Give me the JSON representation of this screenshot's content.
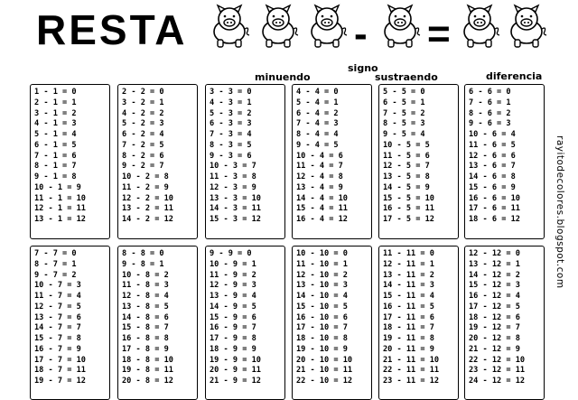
{
  "header": {
    "title": "RESTA",
    "minus_sign": "-",
    "equals_sign": "=",
    "labels": {
      "minuend": "minuendo",
      "sign": "signo",
      "subtrahend": "sustraendo",
      "difference": "diferencia"
    }
  },
  "watermark": "rayitodecolores.blogspot.com",
  "tables": [
    [
      "1 - 1 = 0",
      "2 - 1 = 1",
      "3 - 1 = 2",
      "4 - 1 = 3",
      "5 - 1 = 4",
      "6 - 1 = 5",
      "7 - 1 = 6",
      "8 - 1 = 7",
      "9 - 1 = 8",
      "10 - 1 = 9",
      "11 - 1 = 10",
      "12 - 1 = 11",
      "13 - 1 = 12"
    ],
    [
      "2 - 2 = 0",
      "3 - 2 = 1",
      "4 - 2 = 2",
      "5 - 2 = 3",
      "6 - 2 = 4",
      "7 - 2 = 5",
      "8 - 2 = 6",
      "9 - 2 = 7",
      "10 - 2 = 8",
      "11 - 2 = 9",
      "12 - 2 = 10",
      "13 - 2 = 11",
      "14 - 2 = 12"
    ],
    [
      "3 - 3 = 0",
      "4 - 3 = 1",
      "5 - 3 = 2",
      "6 - 3 = 3",
      "7 - 3 = 4",
      "8 - 3 = 5",
      "9 - 3 = 6",
      "10 - 3 = 7",
      "11 - 3 = 8",
      "12 - 3 = 9",
      "13 - 3 = 10",
      "14 - 3 = 11",
      "15 - 3 = 12"
    ],
    [
      "4 - 4 = 0",
      "5 - 4 = 1",
      "6 - 4 = 2",
      "7 - 4 = 3",
      "8 - 4 = 4",
      "9 - 4 = 5",
      "10 - 4 = 6",
      "11 - 4 = 7",
      "12 - 4 = 8",
      "13 - 4 = 9",
      "14 - 4 = 10",
      "15 - 4 = 11",
      "16 - 4 = 12"
    ],
    [
      "5 - 5 = 0",
      "6 - 5 = 1",
      "7 - 5 = 2",
      "8 - 5 = 3",
      "9 - 5 = 4",
      "10 - 5 = 5",
      "11 - 5 = 6",
      "12 - 5 = 7",
      "13 - 5 = 8",
      "14 - 5 = 9",
      "15 - 5 = 10",
      "16 - 5 = 11",
      "17 - 5 = 12"
    ],
    [
      "6 - 6 = 0",
      "7 - 6 = 1",
      "8 - 6 = 2",
      "9 - 6 = 3",
      "10 - 6 = 4",
      "11 - 6 = 5",
      "12 - 6 = 6",
      "13 - 6 = 7",
      "14 - 6 = 8",
      "15 - 6 = 9",
      "16 - 6 = 10",
      "17 - 6 = 11",
      "18 - 6 = 12"
    ],
    [
      "7 - 7 = 0",
      "8 - 7 = 1",
      "9 - 7 = 2",
      "10 - 7 = 3",
      "11 - 7 = 4",
      "12 - 7 = 5",
      "13 - 7 = 6",
      "14 - 7 = 7",
      "15 - 7 = 8",
      "16 - 7 = 9",
      "17 - 7 = 10",
      "18 - 7 = 11",
      "19 - 7 = 12"
    ],
    [
      "8 - 8 = 0",
      "9 - 8 = 1",
      "10 - 8 = 2",
      "11 - 8 = 3",
      "12 - 8 = 4",
      "13 - 8 = 5",
      "14 - 8 = 6",
      "15 - 8 = 7",
      "16 - 8 = 8",
      "17 - 8 = 9",
      "18 - 8 = 10",
      "19 - 8 = 11",
      "20 - 8 = 12"
    ],
    [
      "9 - 9 = 0",
      "10 - 9 = 1",
      "11 - 9 = 2",
      "12 - 9 = 3",
      "13 - 9 = 4",
      "14 - 9 = 5",
      "15 - 9 = 6",
      "16 - 9 = 7",
      "17 - 9 = 8",
      "18 - 9 = 9",
      "19 - 9 = 10",
      "20 - 9 = 11",
      "21 - 9 = 12"
    ],
    [
      "10 - 10 = 0",
      "11 - 10 = 1",
      "12 - 10 = 2",
      "13 - 10 = 3",
      "14 - 10 = 4",
      "15 - 10 = 5",
      "16 - 10 = 6",
      "17 - 10 = 7",
      "18 - 10 = 8",
      "19 - 10 = 9",
      "20 - 10 = 10",
      "21 - 10 = 11",
      "22 - 10 = 12"
    ],
    [
      "11 - 11 = 0",
      "12 - 11 = 1",
      "13 - 11 = 2",
      "14 - 11 = 3",
      "15 - 11 = 4",
      "16 - 11 = 5",
      "17 - 11 = 6",
      "18 - 11 = 7",
      "19 - 11 = 8",
      "20 - 11 = 9",
      "21 - 11 = 10",
      "22 - 11 = 11",
      "23 - 11 = 12"
    ],
    [
      "12 - 12 = 0",
      "13 - 12 = 1",
      "14 - 12 = 2",
      "15 - 12 = 3",
      "16 - 12 = 4",
      "17 - 12 = 5",
      "18 - 12 = 6",
      "19 - 12 = 7",
      "20 - 12 = 8",
      "21 - 12 = 9",
      "22 - 12 = 10",
      "23 - 12 = 11",
      "24 - 12 = 12"
    ]
  ]
}
